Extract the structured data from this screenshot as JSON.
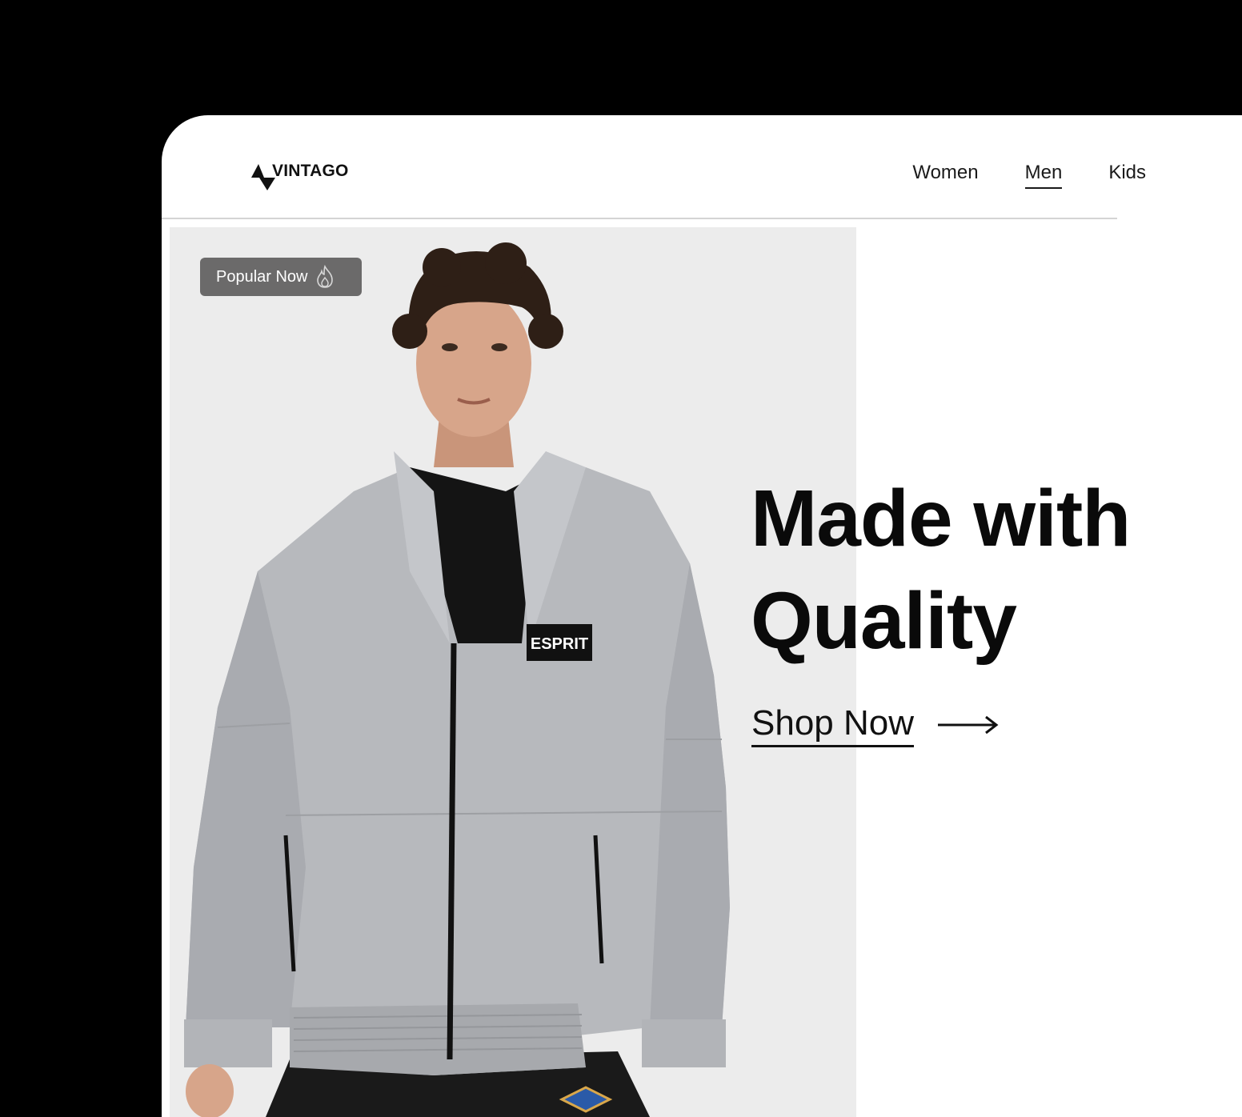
{
  "brand": {
    "name": "VINTAGO",
    "logo_icon": "vintago-logo-icon"
  },
  "nav": {
    "items": [
      {
        "label": "Women",
        "active": false
      },
      {
        "label": "Men",
        "active": true
      },
      {
        "label": "Kids",
        "active": false
      }
    ]
  },
  "hero": {
    "badge": {
      "label": "Popular Now",
      "icon": "fire-icon"
    },
    "headline_line1": "Made with",
    "headline_line2": "Quality",
    "cta": {
      "label": "Shop Now",
      "icon": "arrow-right-icon"
    },
    "image": {
      "subject": "model-wearing-grey-jacket",
      "jacket_patch_text": "ESPRIT",
      "background_color": "#ececec"
    }
  },
  "colors": {
    "page_background": "#000000",
    "card_background": "#ffffff",
    "text": "#111111",
    "badge_background": "#6b6a6a",
    "divider": "#d4d4d4"
  }
}
